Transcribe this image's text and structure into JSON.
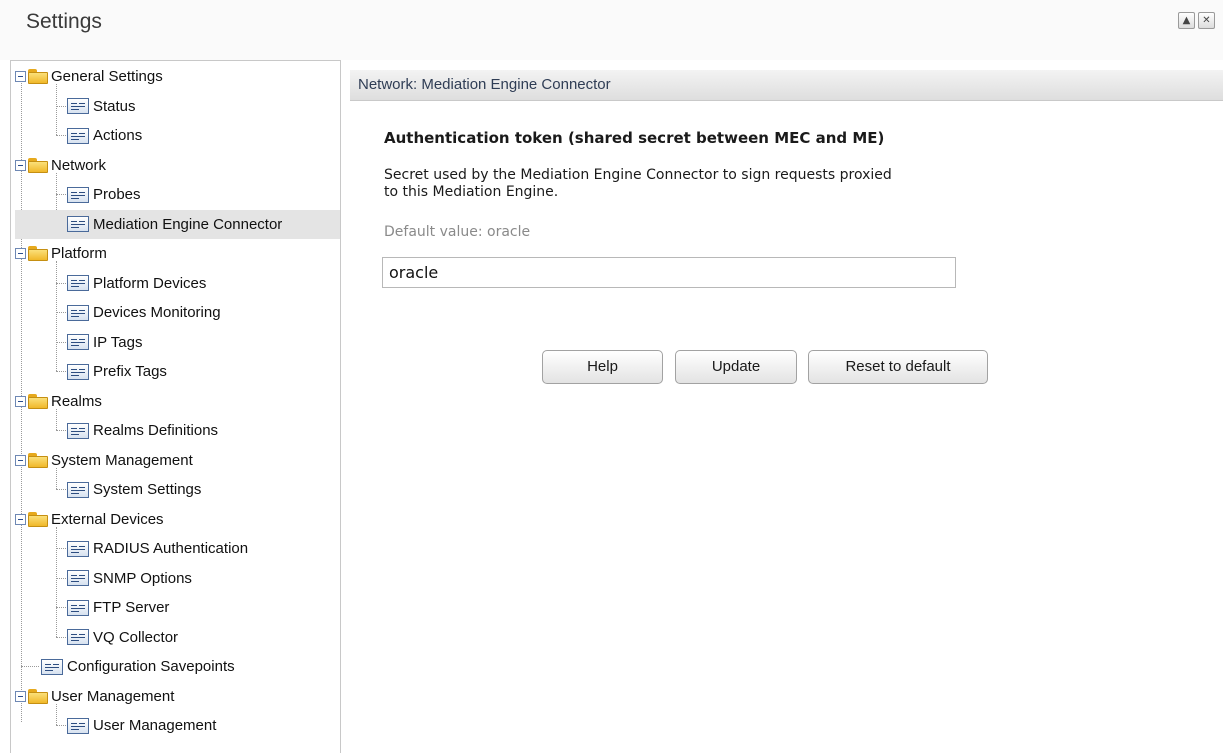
{
  "window": {
    "title": "Settings",
    "controls": [
      {
        "name": "maximize",
        "glyph": "▲"
      },
      {
        "name": "close",
        "glyph": "✕"
      }
    ]
  },
  "tree": {
    "groups": [
      {
        "label": "General Settings",
        "icon": "folder-icon",
        "items": [
          "Status",
          "Actions"
        ]
      },
      {
        "label": "Network",
        "icon": "folder-icon",
        "items": [
          "Probes",
          "Mediation Engine Connector"
        ]
      },
      {
        "label": "Platform",
        "icon": "folder-icon",
        "items": [
          "Platform Devices",
          "Devices Monitoring",
          "IP Tags",
          "Prefix Tags"
        ]
      },
      {
        "label": "Realms",
        "icon": "folder-icon",
        "items": [
          "Realms Definitions"
        ]
      },
      {
        "label": "System Management",
        "icon": "folder-icon",
        "items": [
          "System Settings"
        ]
      },
      {
        "label": "External Devices",
        "icon": "folder-icon",
        "items": [
          "RADIUS Authentication",
          "SNMP Options",
          "FTP Server",
          "VQ Collector"
        ]
      },
      {
        "label": "Configuration Savepoints",
        "icon": "settings-page-icon",
        "items": []
      },
      {
        "label": "User Management",
        "icon": "folder-icon",
        "items": [
          "User Management"
        ]
      }
    ],
    "selected": "Mediation Engine Connector"
  },
  "panel": {
    "header": "Network: Mediation Engine Connector",
    "section_title": "Authentication token (shared secret between MEC and ME)",
    "description_lines": [
      "Secret used by the Mediation Engine Connector to sign requests proxied",
      "to this Mediation Engine."
    ],
    "default_value_text": "Default value: oracle",
    "token_value": "oracle"
  },
  "buttons": {
    "help": "Help",
    "update": "Update",
    "reset": "Reset to default"
  },
  "colors": {
    "folder": "#f0b82a",
    "selected_row": "#e4e4e4",
    "header_text": "#2f3d55"
  }
}
